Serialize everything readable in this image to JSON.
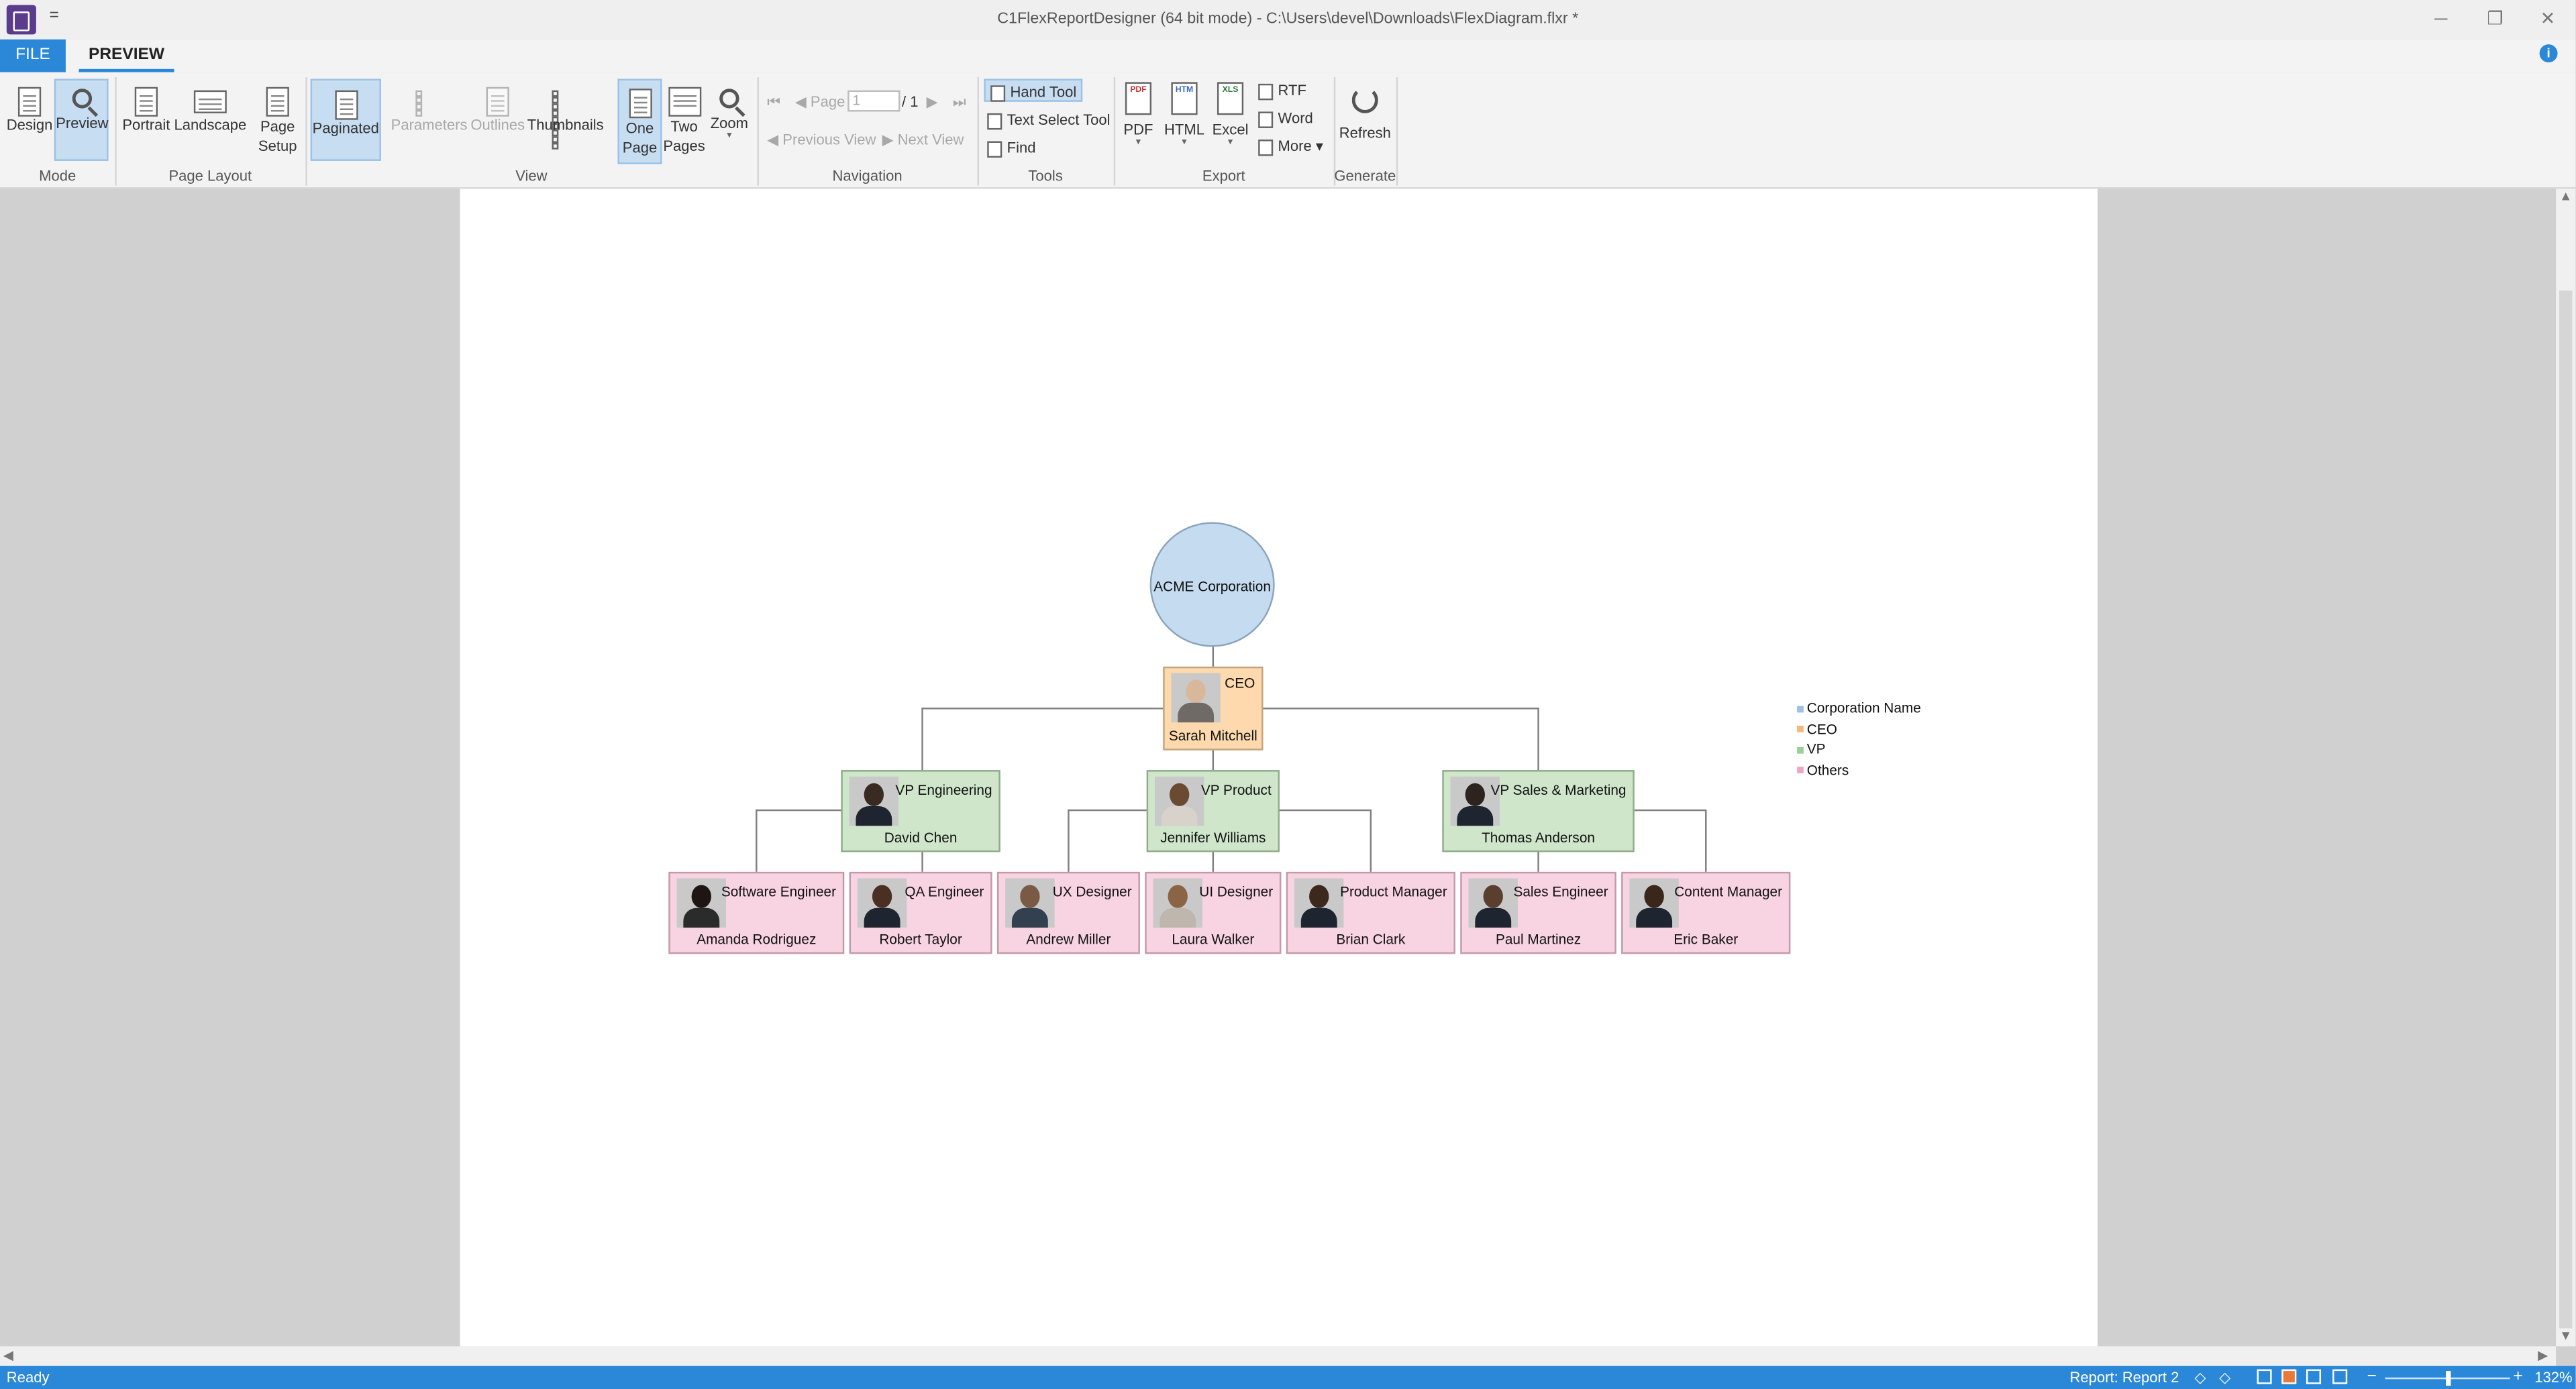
{
  "window": {
    "title": "C1FlexReportDesigner (64 bit mode) - C:\\Users\\devel\\Downloads\\FlexDiagram.flxr *",
    "qat_symbol": "=",
    "minimize": "─",
    "maximize": "❐",
    "close": "✕"
  },
  "tabs": {
    "file": "FILE",
    "preview": "PREVIEW",
    "info": "i"
  },
  "ribbon": {
    "mode": {
      "label": "Mode",
      "design": "Design",
      "preview": "Preview"
    },
    "page_layout": {
      "label": "Page Layout",
      "portrait": "Portrait",
      "landscape": "Landscape",
      "page_setup_1": "Page",
      "page_setup_2": "Setup",
      "paginated": "Paginated"
    },
    "view": {
      "label": "View",
      "parameters": "Parameters",
      "outlines": "Outlines",
      "thumbnails": "Thumbnails",
      "one_page_1": "One",
      "one_page_2": "Page",
      "two_pages_1": "Two",
      "two_pages_2": "Pages",
      "zoom": "Zoom"
    },
    "navigation": {
      "label": "Navigation",
      "page_label": "Page",
      "page_value": "1",
      "page_total": "/ 1",
      "previous_view": "Previous View",
      "next_view": "Next View"
    },
    "tools": {
      "label": "Tools",
      "hand_tool": "Hand Tool",
      "text_select": "Text Select Tool",
      "find": "Find"
    },
    "export": {
      "label": "Export",
      "pdf": "PDF",
      "html": "HTML",
      "excel": "Excel",
      "rtf": "RTF",
      "word": "Word",
      "more": "More"
    },
    "generate": {
      "label": "Generate",
      "refresh": "Refresh"
    }
  },
  "diagram": {
    "corporation": "ACME Corporation",
    "ceo": {
      "role": "CEO",
      "name": "Sarah Mitchell"
    },
    "vps": [
      {
        "role": "VP Engineering",
        "name": "David Chen"
      },
      {
        "role": "VP Product",
        "name": "Jennifer Williams"
      },
      {
        "role": "VP Sales & Marketing",
        "name": "Thomas Anderson"
      }
    ],
    "others": [
      {
        "role": "Software Engineer",
        "name": "Amanda Rodriguez"
      },
      {
        "role": "QA Engineer",
        "name": "Robert Taylor"
      },
      {
        "role": "UX Designer",
        "name": "Andrew Miller"
      },
      {
        "role": "UI Designer",
        "name": "Laura Walker"
      },
      {
        "role": "Product Manager",
        "name": "Brian Clark"
      },
      {
        "role": "Sales Engineer",
        "name": "Paul Martinez"
      },
      {
        "role": "Content Manager",
        "name": "Eric Baker"
      }
    ],
    "legend": [
      {
        "label": "Corporation Name",
        "color": "#9cc3e6"
      },
      {
        "label": "CEO",
        "color": "#f5b87a"
      },
      {
        "label": "VP",
        "color": "#9ccf96"
      },
      {
        "label": "Others",
        "color": "#f0a6c2"
      }
    ],
    "colors": {
      "corporation": "#c5dcf0",
      "ceo": "#fdd9ad",
      "vp": "#cfe6cb",
      "other": "#f8d3e1"
    }
  },
  "status": {
    "ready": "Ready",
    "report": "Report: Report 2",
    "zoom": "132%"
  },
  "theme": {
    "accent": "#2b88d8"
  }
}
